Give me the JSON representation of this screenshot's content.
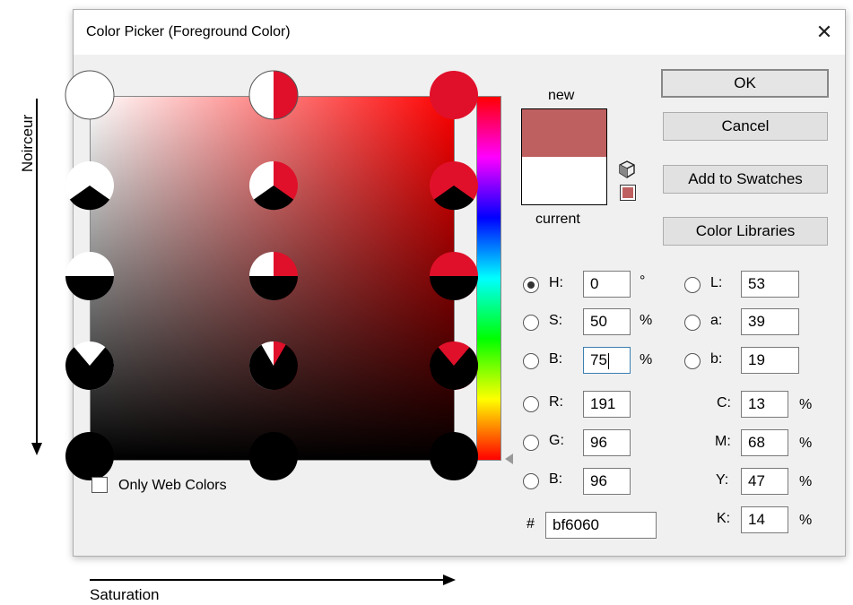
{
  "annotations": {
    "vertical_label": "Noirceur",
    "horizontal_label": "Saturation"
  },
  "dialog": {
    "title": "Color Picker (Foreground Color)",
    "close_glyph": "✕",
    "close_icon": "close-icon"
  },
  "swatch": {
    "new_label": "new",
    "current_label": "current",
    "new_color": "#bf6060",
    "current_color": "#ffffff",
    "gamut_icon": "cube-icon",
    "websafe_icon": "websafe-swatch-icon"
  },
  "buttons": {
    "ok": "OK",
    "cancel": "Cancel",
    "add_to_swatches": "Add to Swatches",
    "color_libraries": "Color Libraries"
  },
  "hsb": {
    "h": {
      "label": "H:",
      "value": "0",
      "unit": "°",
      "selected": true
    },
    "s": {
      "label": "S:",
      "value": "50",
      "unit": "%"
    },
    "b": {
      "label": "B:",
      "value": "75",
      "unit": "%"
    }
  },
  "rgb": {
    "r": {
      "label": "R:",
      "value": "191"
    },
    "g": {
      "label": "G:",
      "value": "96"
    },
    "b": {
      "label": "B:",
      "value": "96"
    }
  },
  "lab": {
    "l": {
      "label": "L:",
      "value": "53"
    },
    "a": {
      "label": "a:",
      "value": "39"
    },
    "b": {
      "label": "b:",
      "value": "19"
    }
  },
  "cmyk": {
    "c": {
      "label": "C:",
      "value": "13",
      "unit": "%"
    },
    "m": {
      "label": "M:",
      "value": "68",
      "unit": "%"
    },
    "y": {
      "label": "Y:",
      "value": "47",
      "unit": "%"
    },
    "k": {
      "label": "K:",
      "value": "14",
      "unit": "%"
    }
  },
  "hex": {
    "label": "#",
    "value": "bf6060"
  },
  "only_web_colors": {
    "label": "Only Web Colors",
    "checked": false
  },
  "colors": {
    "accent_red": "#e0102a",
    "marker_white": "#ffffff",
    "marker_black": "#000000"
  }
}
